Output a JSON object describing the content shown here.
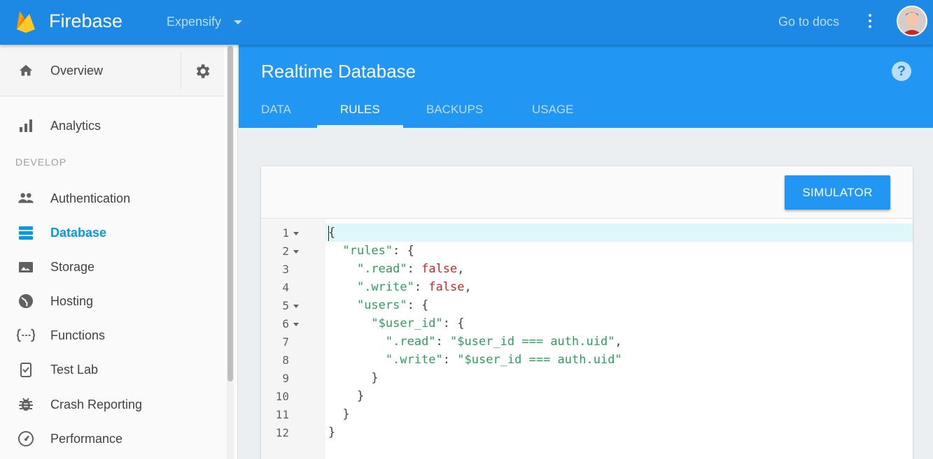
{
  "topbar": {
    "brand": "Firebase",
    "project": "Expensify",
    "docs_link": "Go to docs",
    "brand_color": "#1e88e5"
  },
  "sidebar": {
    "overview": "Overview",
    "analytics": "Analytics",
    "section_develop": "DEVELOP",
    "items": [
      {
        "label": "Authentication",
        "icon": "people-icon"
      },
      {
        "label": "Database",
        "icon": "database-icon",
        "active": true
      },
      {
        "label": "Storage",
        "icon": "photo-icon"
      },
      {
        "label": "Hosting",
        "icon": "globe-icon"
      },
      {
        "label": "Functions",
        "icon": "functions-icon"
      },
      {
        "label": "Test Lab",
        "icon": "clipboard-check-icon"
      },
      {
        "label": "Crash Reporting",
        "icon": "bug-icon"
      },
      {
        "label": "Performance",
        "icon": "speedometer-icon"
      }
    ]
  },
  "main": {
    "title": "Realtime Database",
    "tabs": [
      "DATA",
      "RULES",
      "BACKUPS",
      "USAGE"
    ],
    "active_tab": "RULES",
    "simulator_label": "SIMULATOR"
  },
  "code": {
    "line_numbers": [
      "1",
      "2",
      "3",
      "4",
      "5",
      "6",
      "7",
      "8",
      "9",
      "10",
      "11",
      "12"
    ],
    "lines": [
      "{",
      "  \"rules\": {",
      "    \".read\": false,",
      "    \".write\": false,",
      "    \"users\": {",
      "      \"$user_id\": {",
      "        \".read\": \"$user_id === auth.uid\",",
      "        \".write\": \"$user_id === auth.uid\"",
      "      }",
      "    }",
      "  }",
      "}"
    ]
  }
}
